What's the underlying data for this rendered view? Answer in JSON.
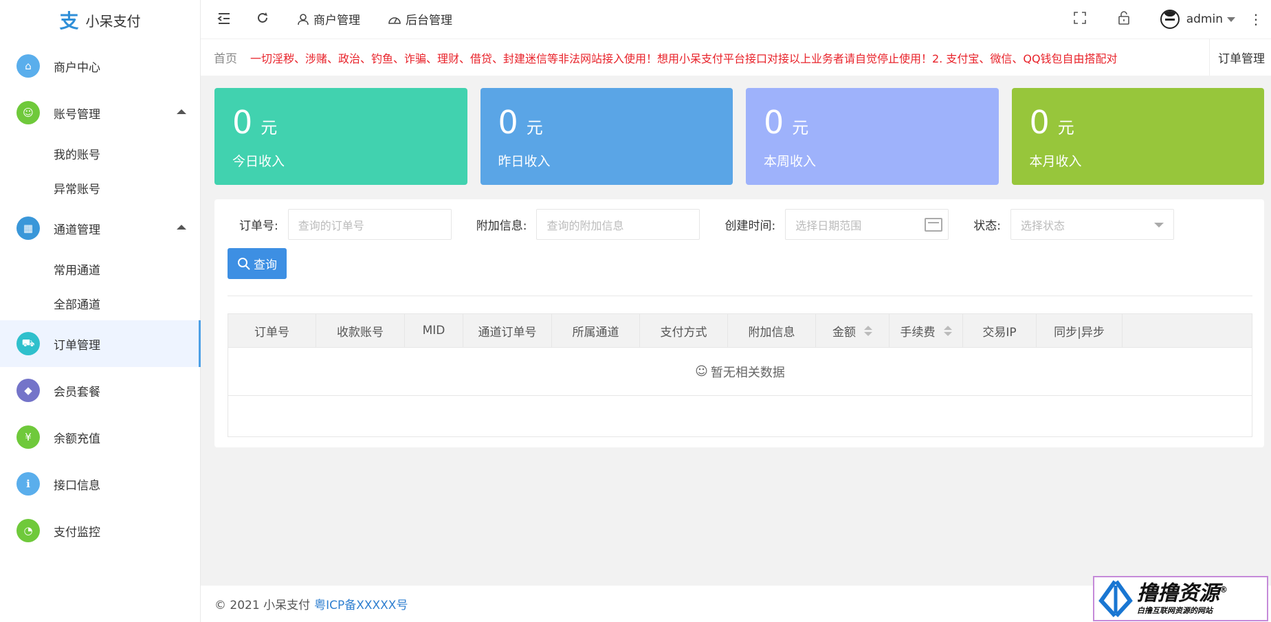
{
  "app": {
    "name": "小呆支付",
    "logo_char": "支"
  },
  "sidebar": {
    "items": [
      {
        "label": "商户中心",
        "color": "#5aaeec",
        "icon": "home-icon",
        "glyph": "⌂"
      },
      {
        "label": "账号管理",
        "color": "#6fc93b",
        "icon": "user-icon",
        "glyph": "☺",
        "expanded": true,
        "children": [
          {
            "label": "我的账号"
          },
          {
            "label": "异常账号"
          }
        ]
      },
      {
        "label": "通道管理",
        "color": "#3a97d9",
        "icon": "apps-icon",
        "glyph": "▦",
        "expanded": true,
        "children": [
          {
            "label": "常用通道"
          },
          {
            "label": "全部通道"
          }
        ]
      },
      {
        "label": "订单管理",
        "color": "#2fc0cc",
        "icon": "cart-icon",
        "glyph": "⛟",
        "active": true
      },
      {
        "label": "会员套餐",
        "color": "#7474c9",
        "icon": "diamond-icon",
        "glyph": "◆"
      },
      {
        "label": "余额充值",
        "color": "#6fc93b",
        "icon": "yen-icon",
        "glyph": "¥"
      },
      {
        "label": "接口信息",
        "color": "#5aaeec",
        "icon": "info-icon",
        "glyph": "ℹ"
      },
      {
        "label": "支付监控",
        "color": "#6fc93b",
        "icon": "gauge-icon",
        "glyph": "◔"
      }
    ]
  },
  "header": {
    "merchant_mgmt": "商户管理",
    "backend_mgmt": "后台管理",
    "user": "admin"
  },
  "crumbbar": {
    "home": "首页",
    "notice": "一切淫秽、涉赌、政治、钓鱼、诈骗、理财、借贷、封建迷信等非法网站接入使用！想用小呆支付平台接口对接以上业务者请自觉停止使用！2. 支付宝、微信、QQ钱包自由搭配对",
    "current_tab": "订单管理"
  },
  "cards": [
    {
      "value": "0",
      "unit": "元",
      "label": "今日收入",
      "color": "#41d2af"
    },
    {
      "value": "0",
      "unit": "元",
      "label": "昨日收入",
      "color": "#5aa5e6"
    },
    {
      "value": "0",
      "unit": "元",
      "label": "本周收入",
      "color": "#9eb2fb"
    },
    {
      "value": "0",
      "unit": "元",
      "label": "本月收入",
      "color": "#97c63b"
    }
  ],
  "filters": {
    "order_no": {
      "label": "订单号:",
      "placeholder": "查询的订单号"
    },
    "extra": {
      "label": "附加信息:",
      "placeholder": "查询的附加信息"
    },
    "created": {
      "label": "创建时间:",
      "placeholder": "选择日期范围"
    },
    "status": {
      "label": "状态:",
      "placeholder": "选择状态"
    },
    "query_button": "查询"
  },
  "table": {
    "columns": [
      {
        "label": "订单号",
        "width": 128
      },
      {
        "label": "收款账号",
        "width": 129
      },
      {
        "label": "MID",
        "width": 85
      },
      {
        "label": "通道订单号",
        "width": 129
      },
      {
        "label": "所属通道",
        "width": 128
      },
      {
        "label": "支付方式",
        "width": 128
      },
      {
        "label": "附加信息",
        "width": 128
      },
      {
        "label": "金额",
        "width": 107,
        "sortable": true
      },
      {
        "label": "手续费",
        "width": 107,
        "sortable": true
      },
      {
        "label": "交易IP",
        "width": 107
      },
      {
        "label": "同步|异步",
        "width": 125
      }
    ],
    "empty_text": "暂无相关数据"
  },
  "footer": {
    "copyright": "© 2021 小呆支付",
    "icp": "粤ICP备XXXXX号"
  },
  "watermark": {
    "title": "撸撸资源",
    "sub": "白撸互联网资源的网站",
    "reg": "®"
  }
}
